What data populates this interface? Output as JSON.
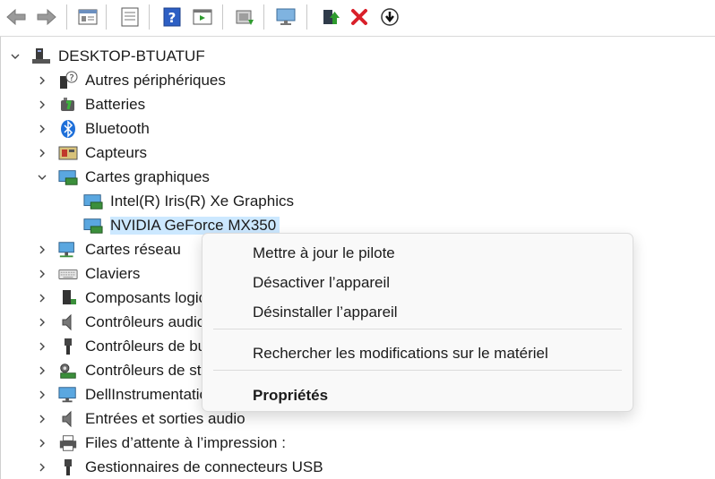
{
  "toolbar": {
    "icons": [
      "back-arrow-icon",
      "forward-arrow-icon",
      "properties-window-icon",
      "list-view-icon",
      "help-icon",
      "action-pane-icon",
      "scan-hardware-icon",
      "monitor-icon",
      "update-driver-icon",
      "uninstall-x-icon",
      "disable-device-icon"
    ]
  },
  "tree": {
    "root": "DESKTOP-BTUATUF",
    "items": [
      {
        "label": "Autres périphériques"
      },
      {
        "label": "Batteries"
      },
      {
        "label": "Bluetooth"
      },
      {
        "label": "Capteurs"
      },
      {
        "label": "Cartes graphiques"
      },
      {
        "label": "Intel(R) Iris(R) Xe Graphics"
      },
      {
        "label": "NVIDIA GeForce MX350"
      },
      {
        "label": "Cartes réseau"
      },
      {
        "label": "Claviers"
      },
      {
        "label": "Composants logiciels"
      },
      {
        "label": "Contrôleurs audio, vidéo et jeu"
      },
      {
        "label": "Contrôleurs de bus USB"
      },
      {
        "label": "Contrôleurs de stockage"
      },
      {
        "label": "DellInstrumentation"
      },
      {
        "label": "Entrées et sorties audio"
      },
      {
        "label": "Files d’attente à l’impression :"
      },
      {
        "label": "Gestionnaires de connecteurs USB"
      }
    ]
  },
  "context_menu": {
    "update_driver": "Mettre à jour le pilote",
    "disable": "Désactiver l’appareil",
    "uninstall": "Désinstaller l’appareil",
    "scan": "Rechercher les modifications sur le matériel",
    "properties": "Propriétés"
  },
  "colors": {
    "selection": "#cce8ff",
    "menu_bg": "#f9f9f9",
    "red_x": "#d9202a",
    "green_arrow": "#2e9b2e"
  }
}
